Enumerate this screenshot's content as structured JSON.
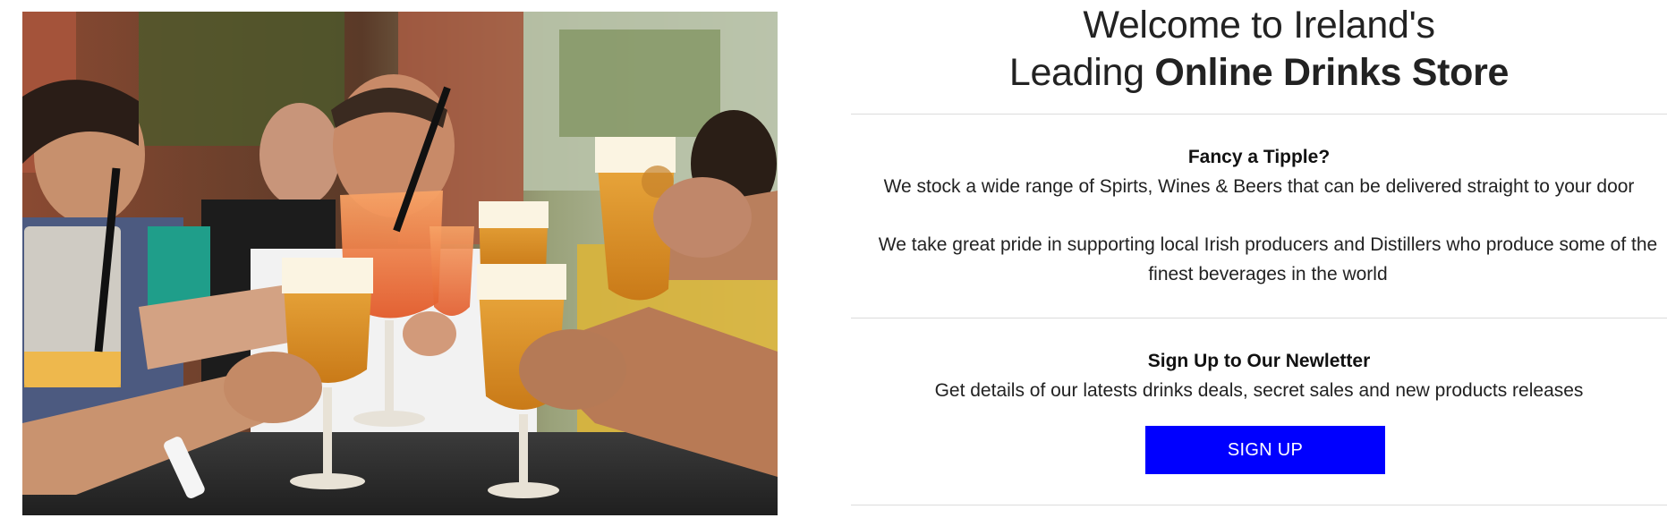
{
  "hero": {
    "line1": "Welcome to Ireland's",
    "line2_normal": "Leading ",
    "line2_bold": "Online Drinks Store"
  },
  "about": {
    "title": "Fancy a Tipple?",
    "line1": "We stock a wide range of Spirts, Wines & Beers that can be delivered straight to your door",
    "line2": "We take great pride in supporting local Irish producers and Distillers who produce some of the finest beverages in the world"
  },
  "newsletter": {
    "title": "Sign Up to Our Newletter",
    "description": "Get details of our latests drinks deals, secret sales and new products releases",
    "button_label": "SIGN UP"
  },
  "photo": {
    "icon": "friends-toasting-drinks-photo"
  },
  "colors": {
    "button_bg": "#0000ff",
    "button_text": "#ffffff",
    "divider": "#dcdcdc"
  }
}
